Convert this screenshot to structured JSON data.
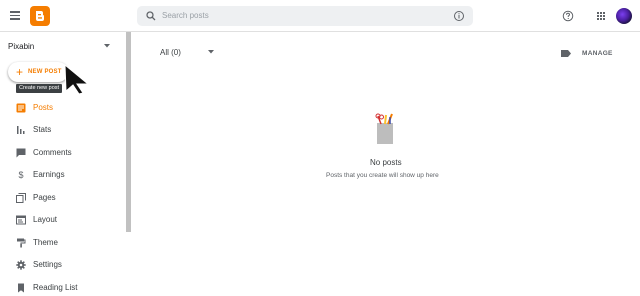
{
  "header": {
    "search_placeholder": "Search posts"
  },
  "sidebar": {
    "blog_name": "Pixabin",
    "new_post_label": "NEW POST",
    "new_post_tooltip": "Create new post",
    "items": [
      {
        "label": "Posts",
        "icon": "posts-icon",
        "active": true
      },
      {
        "label": "Stats",
        "icon": "stats-icon"
      },
      {
        "label": "Comments",
        "icon": "comments-icon"
      },
      {
        "label": "Earnings",
        "icon": "earnings-icon"
      },
      {
        "label": "Pages",
        "icon": "pages-icon"
      },
      {
        "label": "Layout",
        "icon": "layout-icon"
      },
      {
        "label": "Theme",
        "icon": "theme-icon"
      },
      {
        "label": "Settings",
        "icon": "settings-icon"
      },
      {
        "label": "Reading List",
        "icon": "bookmark-icon"
      }
    ]
  },
  "main": {
    "filter_label": "All (0)",
    "manage_label": "MANAGE",
    "empty_title": "No posts",
    "empty_subtitle": "Posts that you create will show up here"
  },
  "colors": {
    "accent": "#f57d00",
    "icon": "#5f6368",
    "text": "#3c4043"
  }
}
